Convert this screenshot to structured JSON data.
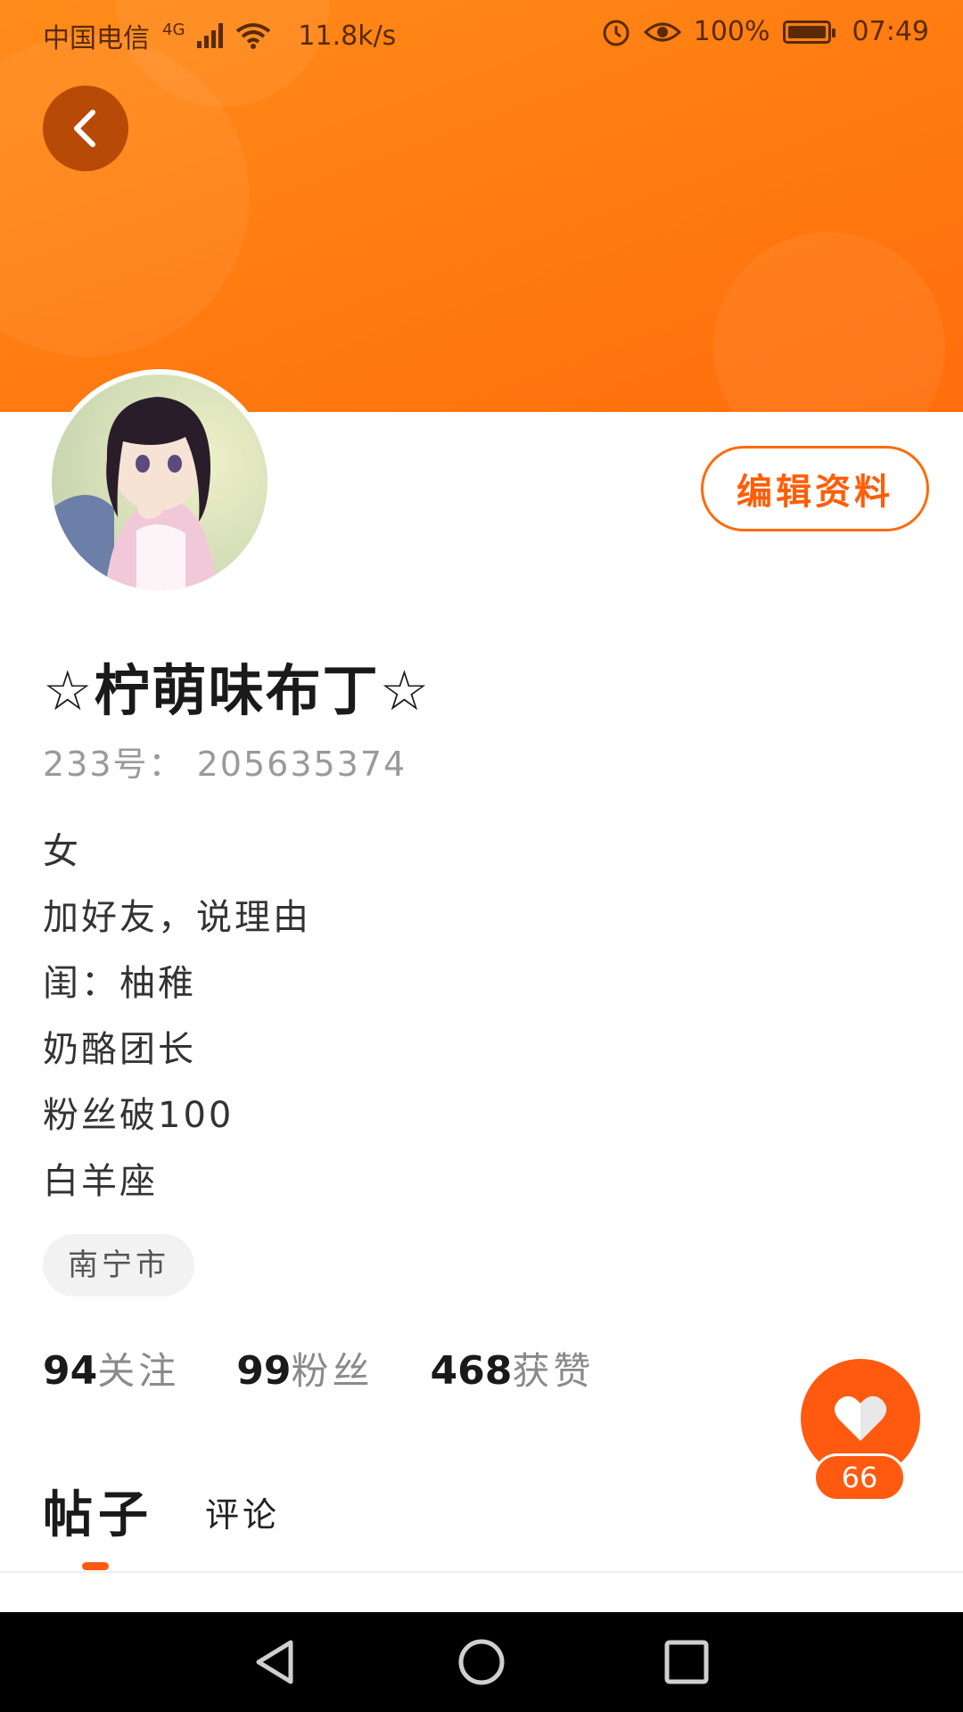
{
  "status_bar": {
    "carrier": "中国电信",
    "network": "4G",
    "speed": "11.8k/s",
    "battery": "100%",
    "time": "07:49"
  },
  "icons": {
    "back": "chevron-left-icon",
    "wifi": "wifi-icon",
    "signal": "signal-icon",
    "alarm": "alarm-icon",
    "eye": "eye-icon",
    "battery": "battery-icon",
    "heart": "heart-icon",
    "nav_back": "triangle-back-icon",
    "nav_home": "circle-home-icon",
    "nav_recent": "square-recent-icon"
  },
  "colors": {
    "accent": "#ff5a10",
    "banner": "#ff7a10"
  },
  "profile": {
    "username": "☆柠萌味布丁☆",
    "uid": "233号： 205635374",
    "edit_button_label": "编辑资料",
    "bio": [
      "女",
      "加好友，说理由",
      "闺：柚稚",
      "奶酪团长",
      "粉丝破100",
      "白羊座"
    ],
    "location": "南宁市"
  },
  "stats": [
    {
      "number": "94",
      "label": "关注"
    },
    {
      "number": "99",
      "label": "粉丝"
    },
    {
      "number": "468",
      "label": "获赞"
    }
  ],
  "like_fab": {
    "count": "66"
  },
  "tabs": [
    {
      "label": "帖子",
      "active": true
    },
    {
      "label": "评论",
      "active": false
    }
  ]
}
